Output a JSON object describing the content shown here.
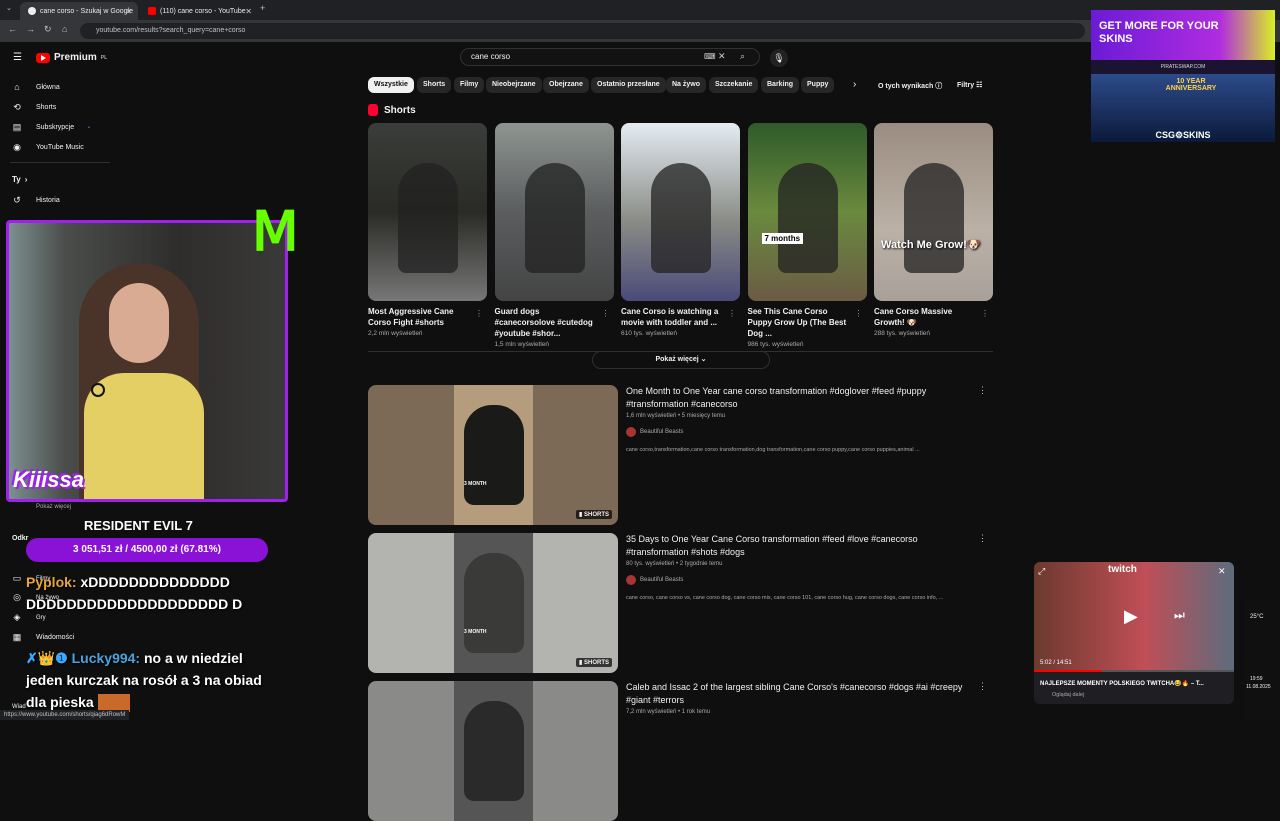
{
  "browser": {
    "tabs": [
      {
        "label": "cane corso - Szukaj w Google"
      },
      {
        "label": "(110) cane corso - YouTube"
      }
    ],
    "url": "youtube.com/results?search_query=cane+corso",
    "status_url": "https://www.youtube.com/shorts/qiag6dRowM"
  },
  "header": {
    "logo": "Premium",
    "logo_sup": "PL",
    "search_value": "cane corso"
  },
  "sidebar": {
    "items": [
      {
        "label": "Główna",
        "icon": "home-icon"
      },
      {
        "label": "Shorts",
        "icon": "shorts-icon"
      },
      {
        "label": "Subskrypcje",
        "icon": "subscriptions-icon"
      },
      {
        "label": "YouTube Music",
        "icon": "music-icon"
      }
    ],
    "you_header": "Ty",
    "history": "Historia",
    "more_label": "Pokaż więcej",
    "section_label": "Odkr",
    "lower_items": [
      "Filmy",
      "Na żywo",
      "Gry",
      "Wiadomości"
    ],
    "bottom_label": "Wiad"
  },
  "chips": [
    {
      "label": "Wszystkie",
      "active": true
    },
    {
      "label": "Shorts"
    },
    {
      "label": "Filmy"
    },
    {
      "label": "Nieobejrzane"
    },
    {
      "label": "Obejrzane"
    },
    {
      "label": "Ostatnio przesłane"
    },
    {
      "label": "Na żywo"
    },
    {
      "label": "Szczekanie"
    },
    {
      "label": "Barking"
    },
    {
      "label": "Puppy"
    }
  ],
  "results_about": "O tych wynikach",
  "filters": "Filtry",
  "shorts_section": {
    "heading": "Shorts",
    "items": [
      {
        "title": "Most Aggressive Cane Corso Fight #shorts",
        "views": "2,2 mln wyświetleń",
        "overlay": ""
      },
      {
        "title": "Guard dogs #canecorsolove #cutedog #youtube #shor...",
        "views": "1,5 mln wyświetleń",
        "overlay": ""
      },
      {
        "title": "Cane Corso is watching a movie with toddler and ...",
        "views": "610 tys. wyświetleń",
        "overlay": ""
      },
      {
        "title": "See This Cane Corso Puppy Grow Up (The Best Dog ...",
        "views": "986 tys. wyświetleń",
        "overlay": "7 months"
      },
      {
        "title": "Cane Corso Massive Growth! 🐶",
        "views": "288 tys. wyświetleń",
        "overlay": "Watch Me Grow!🐶"
      }
    ],
    "show_more": "Pokaż więcej"
  },
  "videos": [
    {
      "title": "One Month to One Year cane corso transformation #doglover #feed #puppy #transformation #canecorso",
      "meta": "1,6 mln wyświetleń • 5 miesięcy temu",
      "channel": "Beautiful Beasts",
      "desc": "cane corso,transformation,cane corso transformation,dog transformation,cane corso puppy,cane corso puppies,animal ...",
      "badge": "SHORTS",
      "thumb_text": "3 MONTH"
    },
    {
      "title": "35 Days to One Year Cane Corso transformation #feed #love #canecorso #transformation #shots #dogs",
      "meta": "80 tys. wyświetleń • 2 tygodnie temu",
      "channel": "Beautiful Beasts",
      "desc": "cane corso, cane corso vs, cane corso dog, cane corso mix, cane corso 101, cane corso hug, cane corso dogs, cane corso info, ...",
      "badge": "SHORTS",
      "thumb_text": "3 MONTH"
    },
    {
      "title": "Caleb and Issac 2 of the largest sibling Cane Corso's #canecorso #dogs #ai #creepy #giant #terrors",
      "meta": "7,2 mln wyświetleń • 1 rok temu",
      "channel": "",
      "desc": "",
      "badge": "",
      "thumb_text": ""
    }
  ],
  "stream_overlay": {
    "streamer": "Kiiissa",
    "game": "RESIDENT EVIL 7",
    "goal": "3 051,51 zł / 4500,00 zł (67.81%)",
    "chat": [
      {
        "user": "Pyplok:",
        "text": "xDDDDDDDDDDDDDD DDDDDDDDDDDDDDDDDDDD D"
      },
      {
        "user": "Lucky994:",
        "text": "no a w niedziel jeden kurczak na rosół a 3 na obiad dla pieska"
      }
    ]
  },
  "ad": {
    "headline": "GET MORE FOR YOUR SKINS",
    "site": "PIRATESWAP.COM",
    "anniv": "10 YEAR ANNIVERSARY",
    "brand": "CSG⚙SKINS"
  },
  "twitch_mini": {
    "logo": "twitch",
    "time": "5:02 / 14:51",
    "title": "NAJLEPSZE MOMENTY POLSKIEGO TWITCHA😂🔥 – T...",
    "sub": "Oglądaj dalej"
  },
  "tray": {
    "temp": "25°C",
    "time": "19:59",
    "date": "11.08.2025"
  },
  "colors": {
    "accent": "#ff0000",
    "overlay_purple": "#a020f0",
    "twitch": "#9146ff"
  }
}
